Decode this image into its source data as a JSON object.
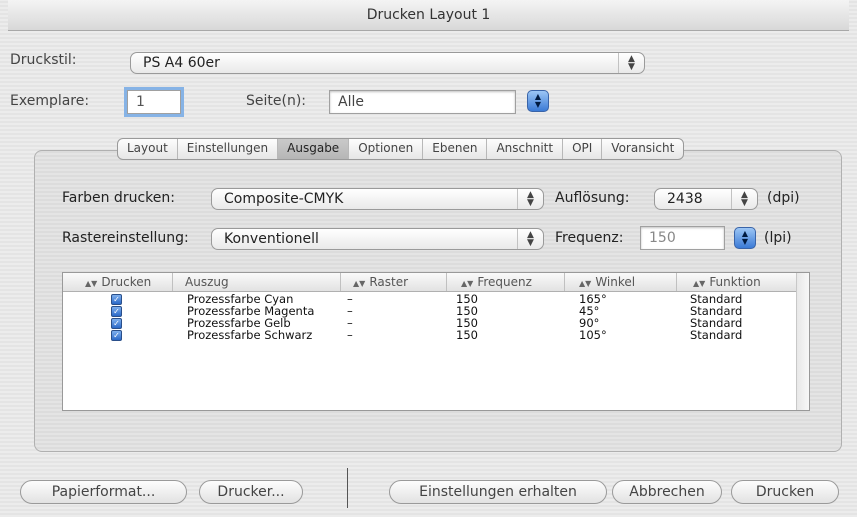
{
  "window": {
    "title": "Drucken Layout 1"
  },
  "druckstil": {
    "label": "Druckstil:",
    "value": "PS A4 60er"
  },
  "exemplare": {
    "label": "Exemplare:",
    "value": "1"
  },
  "seiten": {
    "label": "Seite(n):",
    "value": "Alle"
  },
  "tabs": [
    {
      "label": "Layout"
    },
    {
      "label": "Einstellungen"
    },
    {
      "label": "Ausgabe"
    },
    {
      "label": "Optionen"
    },
    {
      "label": "Ebenen"
    },
    {
      "label": "Anschnitt"
    },
    {
      "label": "OPI"
    },
    {
      "label": "Voransicht"
    }
  ],
  "selected_tab": "Ausgabe",
  "farben": {
    "label": "Farben drucken:",
    "value": "Composite-CMYK"
  },
  "aufloesung": {
    "label": "Auflösung:",
    "value": "2438",
    "unit": "(dpi)"
  },
  "raster": {
    "label": "Rastereinstellung:",
    "value": "Konventionell"
  },
  "frequenz": {
    "label": "Frequenz:",
    "value": "150",
    "unit": "(lpi)"
  },
  "table": {
    "columns": [
      "Drucken",
      "Auszug",
      "Raster",
      "Frequenz",
      "Winkel",
      "Funktion"
    ],
    "rows": [
      {
        "drucken": true,
        "auszug": "Prozessfarbe Cyan",
        "raster": "–",
        "frequenz": "150",
        "winkel": "165°",
        "funktion": "Standard"
      },
      {
        "drucken": true,
        "auszug": "Prozessfarbe Magenta",
        "raster": "–",
        "frequenz": "150",
        "winkel": "45°",
        "funktion": "Standard"
      },
      {
        "drucken": true,
        "auszug": "Prozessfarbe Gelb",
        "raster": "–",
        "frequenz": "150",
        "winkel": "90°",
        "funktion": "Standard"
      },
      {
        "drucken": true,
        "auszug": "Prozessfarbe Schwarz",
        "raster": "–",
        "frequenz": "150",
        "winkel": "105°",
        "funktion": "Standard"
      }
    ]
  },
  "buttons": {
    "papierformat": "Papierformat...",
    "drucker": "Drucker...",
    "einstellungen": "Einstellungen erhalten",
    "abbrechen": "Abbrechen",
    "drucken": "Drucken"
  },
  "colors": {
    "accent": "#3b7ad6",
    "focus_ring": "#86b3e6",
    "checkbox": "#2a68c8"
  },
  "icons": {
    "popup_arrows": "up-down-arrows-icon",
    "stepper": "stepper-icon",
    "checkbox": "checkbox-checked-icon",
    "sort": "sort-icon"
  }
}
